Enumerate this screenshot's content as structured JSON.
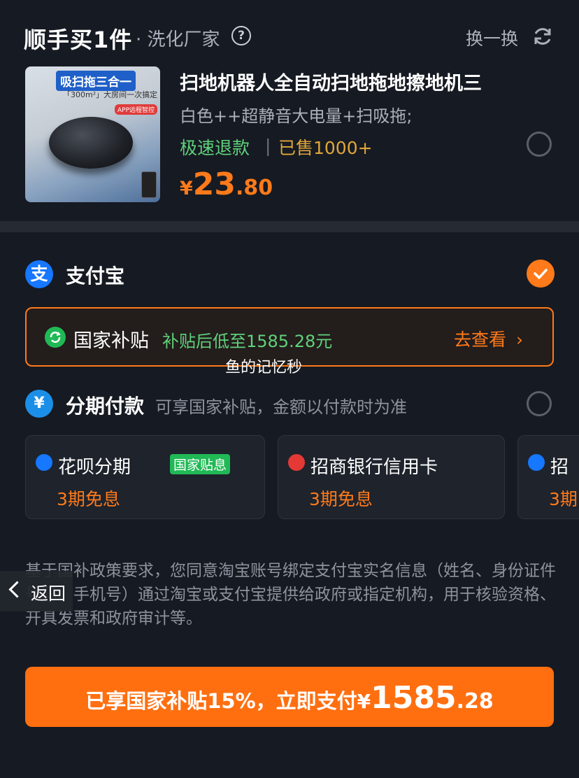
{
  "header": {
    "brand": "顺手买1件",
    "brand_sub": "· 洗化厂家",
    "help_icon": "help-circle-icon",
    "swap_label": "换一换",
    "swap_icon": "refresh-icon"
  },
  "product": {
    "image_badge": "吸扫拖三合一",
    "image_line2": "「300m²」大房间一次搞定",
    "image_app_tag": "APP远程智控",
    "title": "扫地机器人全自动扫地拖地擦地机三",
    "variant": "白色++超静音大电量+扫吸拖;",
    "refund": "极速退款",
    "separator": "|",
    "sold": "已售1000+",
    "price_currency": "¥",
    "price_integer": "23",
    "price_decimal": ".80",
    "selected": false
  },
  "payment": {
    "alipay": {
      "label": "支付宝",
      "icon": "alipay-icon",
      "icon_glyph": "支",
      "selected": true
    },
    "subsidy": {
      "label": "国家补贴",
      "description": "补贴后低至1585.28元",
      "view_label": "去查看",
      "chevron": "›"
    },
    "watermark": "鱼的记忆秒",
    "installment": {
      "label": "分期付款",
      "icon_glyph": "¥",
      "description": "可享国家补贴，金额以付款时为准",
      "selected": false,
      "cards": [
        {
          "title": "花呗分期",
          "tag": "国家贴息",
          "subtitle": "3期免息",
          "icon": "huabei-icon",
          "icon_color": "#1677ff"
        },
        {
          "title": "招商银行信用卡",
          "subtitle": "3期免息",
          "icon": "cmb-icon",
          "icon_color": "#e53935"
        },
        {
          "title": "招",
          "subtitle": "3期",
          "icon": "bank-icon",
          "icon_color": "#1677ff"
        }
      ]
    }
  },
  "policy": {
    "text": "基于国补政策要求，您同意淘宝账号绑定支付宝实名信息（姓名、身份证件号码、手机号）通过淘宝或支付宝提供给政府或指定机构，用于核验资格、开具发票和政府审计等。"
  },
  "back": {
    "label": "返回"
  },
  "pay_button": {
    "label": "已享国家补贴15%，立即支付",
    "currency": "¥",
    "amount_integer": "1585",
    "amount_decimal": ".28"
  },
  "colors": {
    "background": "#161a22",
    "accent": "#ff7a1a",
    "green": "#5fd17a",
    "alipay_blue": "#1677ff"
  }
}
